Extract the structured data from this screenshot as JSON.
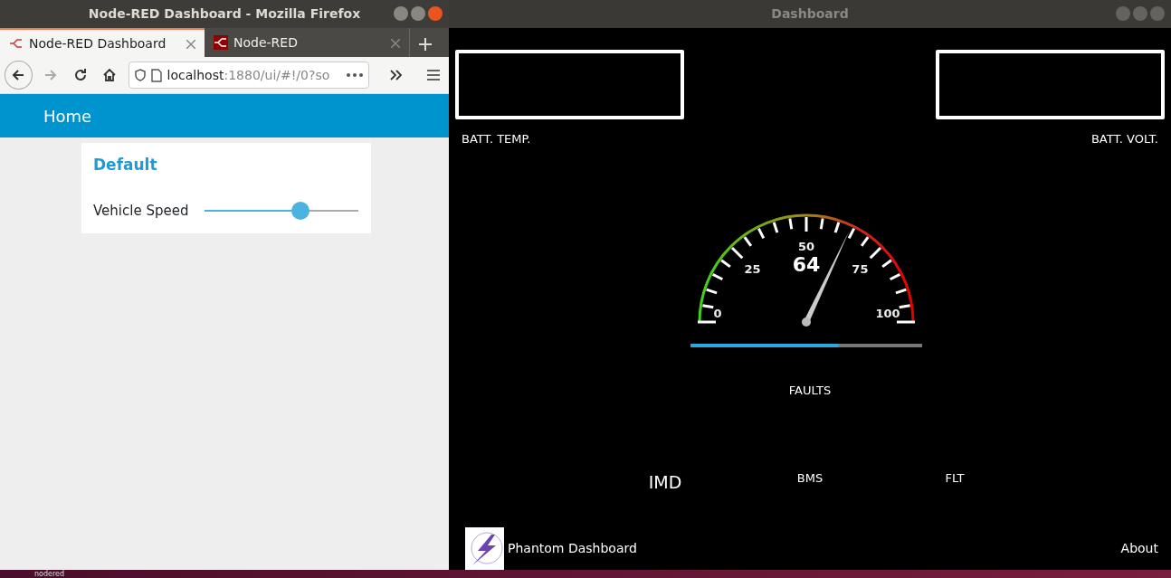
{
  "firefox": {
    "title": "Node-RED Dashboard - Mozilla Firefox",
    "tabs": [
      {
        "label": "Node-RED Dashboard",
        "selected": true
      },
      {
        "label": "Node-RED",
        "selected": false
      }
    ],
    "address": {
      "host": "localhost",
      "path": ":1880/ui/#!/0?so"
    },
    "page": {
      "title": "Home",
      "group": "Default",
      "slider": {
        "label": "Vehicle Speed",
        "level": 0.64
      }
    }
  },
  "dashboard": {
    "title": "Dashboard",
    "readouts": [
      {
        "label": "BATT. TEMP."
      },
      {
        "label": "BATT. VOLT."
      }
    ],
    "gauge": {
      "value": "64",
      "level": 0.64,
      "ticks": [
        "0",
        "25",
        "50",
        "75",
        "100"
      ]
    },
    "bar": {
      "level": 0.64
    },
    "faults": {
      "title": "FAULTS",
      "items": [
        {
          "label": "IMD",
          "active": true
        },
        {
          "label": "BMS",
          "active": false
        },
        {
          "label": "FLT",
          "active": false
        }
      ]
    },
    "footer": {
      "title": "Phantom Dashboard",
      "link": "About"
    }
  },
  "desktop": {
    "icon_label": "nodered"
  }
}
